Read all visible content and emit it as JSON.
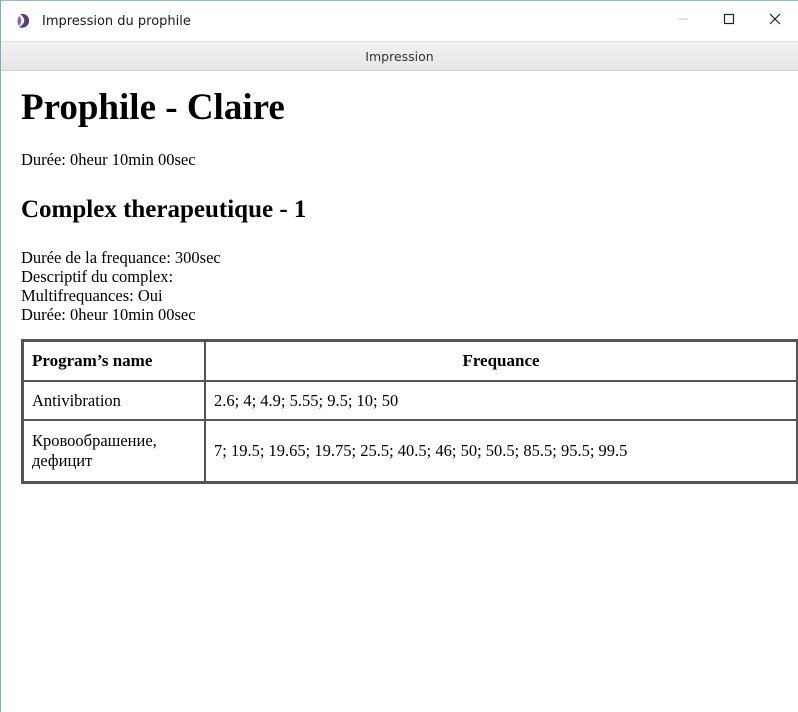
{
  "window": {
    "title": "Impression du prophile",
    "icon": "app-logo-icon",
    "controls": {
      "minimize": "minimize-icon",
      "maximize": "maximize-icon",
      "close": "close-icon"
    }
  },
  "menubar": {
    "print_label": "Impression"
  },
  "profile": {
    "heading": "Prophile - Claire",
    "duration": "Durée: 0heur 10min 00sec"
  },
  "complex": {
    "heading": "Complex therapeutique - 1",
    "frequency_duration": "Durée de la frequance: 300sec",
    "description": "Descriptif du complex:",
    "multifrequency": "Multifrequances: Oui",
    "duration": "Durée: 0heur 10min 00sec"
  },
  "table": {
    "headers": [
      "Program’s name",
      "Frequance"
    ],
    "rows": [
      {
        "name": "Antivibration",
        "frequencies": "2.6; 4; 4.9; 5.55; 9.5; 10; 50"
      },
      {
        "name": "Кровообрашение, дефицит",
        "frequencies": "7; 19.5; 19.65; 19.75; 25.5; 40.5; 46; 50; 50.5; 85.5; 95.5; 99.5"
      }
    ]
  },
  "colors": {
    "window_border": "#7fa7c9",
    "menubar_bg": "#e6e6e6",
    "table_border": "#555555"
  }
}
